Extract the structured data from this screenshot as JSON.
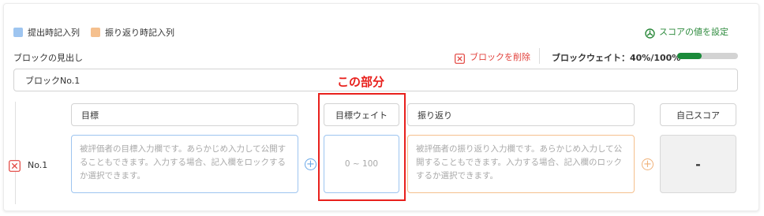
{
  "legend": {
    "items": [
      {
        "label": "提出時記入列",
        "color": "#9ec5f0"
      },
      {
        "label": "振り返り時記入列",
        "color": "#f5c08e"
      }
    ]
  },
  "score_setting_link": "スコアの値を設定",
  "block": {
    "heading_label": "ブロックの見出し",
    "delete_label": "ブロックを削除",
    "weight_label": "ブロックウェイト：40%/100%",
    "weight_progress": 0.4,
    "title_value": "ブロックNo.1"
  },
  "annotation": {
    "label": "この部分"
  },
  "columns": {
    "goal": "目標",
    "goal_weight": "目標ウェイト",
    "reflection": "振り返り",
    "self_score": "自己スコア"
  },
  "row": {
    "label": "No.1",
    "goal_placeholder": "被評価者の目標入力欄です。あらかじめ入力して公開することもできます。入力する場合、記入欄をロックするか選択できます。",
    "weight_placeholder": "0 ~ 100",
    "reflection_placeholder": "被評価者の振り返り入力欄です。あらかじめ入力して公開することもできます。入力する場合、記入欄のロックするか選択できます。",
    "self_score_value": "-"
  },
  "colors": {
    "accent_green": "#2e8b3e",
    "danger_red": "#e2413b",
    "annotation_red": "#e8201c",
    "blue_border": "#9ec5f0",
    "orange_border": "#f5c08e"
  }
}
